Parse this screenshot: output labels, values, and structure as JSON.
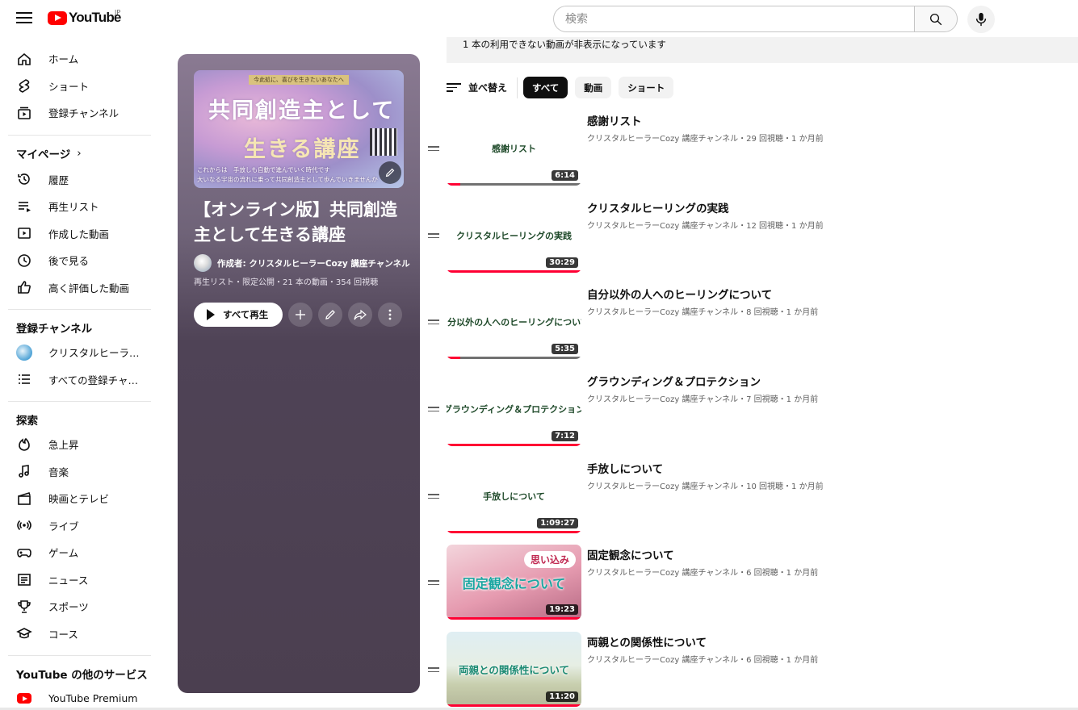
{
  "header": {
    "logo_text": "YouTube",
    "region": "JP",
    "search_placeholder": "検索"
  },
  "sidebar": {
    "main": [
      {
        "label": "ホーム",
        "icon": "home-icon"
      },
      {
        "label": "ショート",
        "icon": "shorts-icon"
      },
      {
        "label": "登録チャンネル",
        "icon": "subscriptions-icon"
      }
    ],
    "mypage_title": "マイページ",
    "mypage": [
      {
        "label": "履歴",
        "icon": "history-icon"
      },
      {
        "label": "再生リスト",
        "icon": "playlist-icon"
      },
      {
        "label": "作成した動画",
        "icon": "your-videos-icon"
      },
      {
        "label": "後で見る",
        "icon": "watch-later-icon"
      },
      {
        "label": "高く評価した動画",
        "icon": "liked-icon"
      }
    ],
    "subs_title": "登録チャンネル",
    "subs": [
      {
        "label": "クリスタルヒーラ…",
        "icon": "channel-avatar"
      },
      {
        "label": "すべての登録チャ…",
        "icon": "list-icon"
      }
    ],
    "explore_title": "探索",
    "explore": [
      {
        "label": "急上昇",
        "icon": "trending-icon"
      },
      {
        "label": "音楽",
        "icon": "music-icon"
      },
      {
        "label": "映画とテレビ",
        "icon": "movies-icon"
      },
      {
        "label": "ライブ",
        "icon": "live-icon"
      },
      {
        "label": "ゲーム",
        "icon": "gaming-icon"
      },
      {
        "label": "ニュース",
        "icon": "news-icon"
      },
      {
        "label": "スポーツ",
        "icon": "sports-icon"
      },
      {
        "label": "コース",
        "icon": "courses-icon"
      }
    ],
    "more_title": "YouTube の他のサービス",
    "more": [
      {
        "label": "YouTube Premium",
        "icon": "youtube-premium-icon"
      }
    ]
  },
  "playlist": {
    "thumb_ribbon": "今此処に、喜びを生きたいあなたへ",
    "thumb_line1": "共同創造主として",
    "thumb_line2": "生きる講座",
    "thumb_sub1": "これからは　手放しも自動で進んでいく時代です",
    "thumb_sub2": "大いなる宇宙の流れに乗って共同創造主として歩んでいきませんか",
    "title": "【オンライン版】共同創造主として生きる講座",
    "owner": "作成者: クリスタルヒーラーCozy 講座チャンネル",
    "meta": "再生リスト・限定公開・21 本の動画・354 回視聴",
    "play_all": "すべて再生"
  },
  "notice": "1 本の利用できない動画が非表示になっています",
  "filters": {
    "sort_label": "並べ替え",
    "chips": [
      "すべて",
      "動画",
      "ショート"
    ],
    "active_chip": "すべて"
  },
  "videos": [
    {
      "title": "感謝リスト",
      "thumb_text": "感謝リスト",
      "duration": "6:14",
      "meta": "クリスタルヒーラーCozy 講座チャンネル・29 回視聴・1 か月前",
      "progress": 0.1
    },
    {
      "title": "クリスタルヒーリングの実践",
      "thumb_text": "クリスタルヒーリングの実践",
      "duration": "30:29",
      "meta": "クリスタルヒーラーCozy 講座チャンネル・12 回視聴・1 か月前",
      "progress": 1.0
    },
    {
      "title": "自分以外の人へのヒーリングについて",
      "thumb_text": "自分以外の人へのヒーリングについて",
      "duration": "5:35",
      "meta": "クリスタルヒーラーCozy 講座チャンネル・8 回視聴・1 か月前",
      "progress": 0.1
    },
    {
      "title": "グラウンディング＆プロテクション",
      "thumb_text": "グラウンディング＆プロテクション",
      "duration": "7:12",
      "meta": "クリスタルヒーラーCozy 講座チャンネル・7 回視聴・1 か月前",
      "progress": 1.0
    },
    {
      "title": "手放しについて",
      "thumb_text": "手放しについて",
      "duration": "1:09:27",
      "meta": "クリスタルヒーラーCozy 講座チャンネル・10 回視聴・1 か月前",
      "progress": 1.0
    },
    {
      "title": "固定観念について",
      "thumb_text": "固定観念について",
      "thumb_bubble": "思い込み",
      "duration": "19:23",
      "meta": "クリスタルヒーラーCozy 講座チャンネル・6 回視聴・1 か月前",
      "progress": 1.0
    },
    {
      "title": "両親との関係性について",
      "thumb_text": "両親との関係性について",
      "duration": "11:20",
      "meta": "クリスタルヒーラーCozy 講座チャンネル・6 回視聴・1 か月前",
      "progress": 1.0
    }
  ]
}
